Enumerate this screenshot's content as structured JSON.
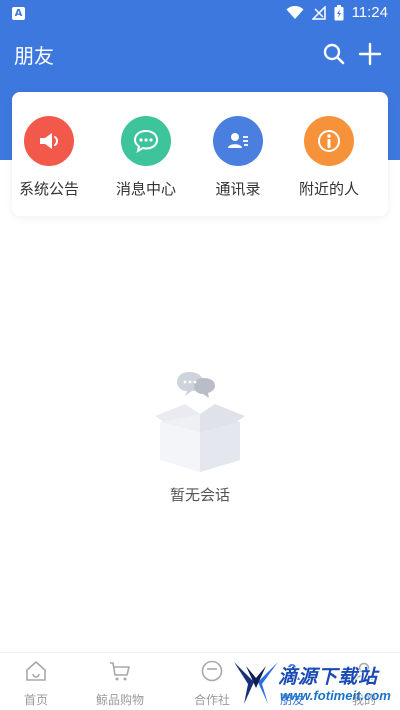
{
  "status_bar": {
    "time": "11:24",
    "icons": [
      "app-a-icon",
      "wifi-icon",
      "no-signal-icon",
      "battery-charging-icon"
    ]
  },
  "app_bar": {
    "title": "朋友",
    "actions": [
      "search-icon",
      "plus-icon"
    ]
  },
  "quick_actions": [
    {
      "label": "系统公告",
      "icon": "megaphone-icon",
      "color": "#f2594b"
    },
    {
      "label": "消息中心",
      "icon": "chat-bubble-icon",
      "color": "#3ec49a"
    },
    {
      "label": "通讯录",
      "icon": "contact-card-icon",
      "color": "#4a7fe0"
    },
    {
      "label": "附近的人",
      "icon": "info-person-icon",
      "color": "#f5923a"
    }
  ],
  "empty_state": {
    "text": "暂无会话",
    "icon": "empty-box-icon"
  },
  "bottom_nav": [
    {
      "label": "首页",
      "icon": "home-icon"
    },
    {
      "label": "鲸品购物",
      "icon": "cart-icon"
    },
    {
      "label": "合作社",
      "icon": "cooperative-icon"
    },
    {
      "label": "朋友",
      "icon": "friends-icon",
      "active": true
    },
    {
      "label": "我的",
      "icon": "profile-icon"
    }
  ],
  "watermark": {
    "text": "滴源下载站",
    "url": "www.fotimeit.com"
  },
  "colors": {
    "primary": "#3d78df",
    "text": "#333333",
    "muted": "#9a9a9a"
  }
}
